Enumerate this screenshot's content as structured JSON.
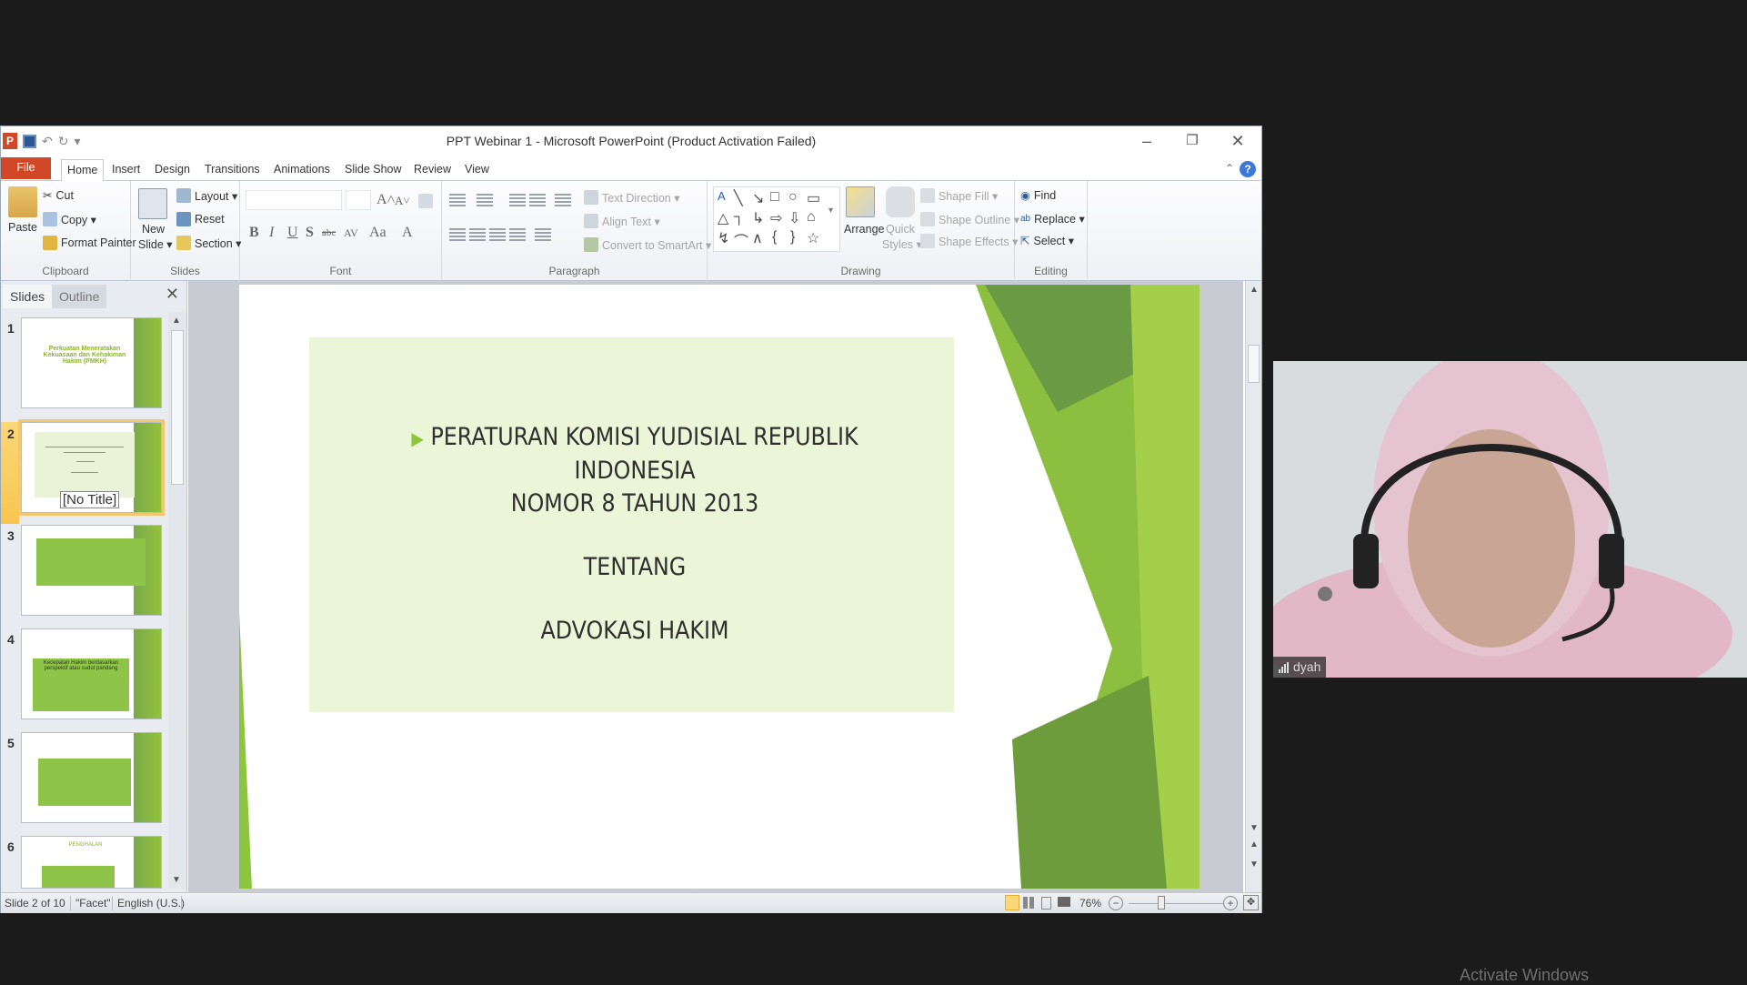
{
  "window": {
    "title": "PPT Webinar 1 - Microsoft PowerPoint (Product Activation Failed)",
    "app_icon_letter": "P",
    "controls": {
      "minimize": "–",
      "restore": "❐",
      "close": "✕"
    }
  },
  "quick_access": {
    "undo": "↶",
    "redo": "↻",
    "customize": "▾"
  },
  "tabs": [
    {
      "label": "File"
    },
    {
      "label": "Home",
      "active": true
    },
    {
      "label": "Insert"
    },
    {
      "label": "Design"
    },
    {
      "label": "Transitions"
    },
    {
      "label": "Animations"
    },
    {
      "label": "Slide Show"
    },
    {
      "label": "Review"
    },
    {
      "label": "View"
    }
  ],
  "help_label": "?",
  "ribbon": {
    "clipboard": {
      "label": "Clipboard",
      "paste": "Paste",
      "cut": "Cut",
      "copy": "Copy ▾",
      "format_painter": "Format Painter"
    },
    "slides": {
      "label": "Slides",
      "new_slide": "New",
      "new_slide2": "Slide ▾",
      "layout": "Layout ▾",
      "reset": "Reset",
      "section": "Section ▾"
    },
    "font": {
      "label": "Font",
      "font_name": "",
      "font_size": "",
      "bold": "B",
      "italic": "I",
      "underline": "U",
      "shadow": "S",
      "strike": "abc",
      "spacing": "AV",
      "case": "Aa",
      "color": "A",
      "grow": "A˄",
      "shrink": "A˅"
    },
    "paragraph": {
      "label": "Paragraph",
      "text_direction": "Text Direction ▾",
      "align_text": "Align Text ▾",
      "convert_smartart": "Convert to SmartArt ▾"
    },
    "drawing": {
      "label": "Drawing",
      "arrange": "Arrange",
      "quick_styles": "Quick",
      "quick_styles2": "Styles ▾",
      "shape_fill": "Shape Fill ▾",
      "shape_outline": "Shape Outline ▾",
      "shape_effects": "Shape Effects ▾",
      "shapes": [
        "╲",
        "↘",
        "□",
        "○",
        "▭",
        "△",
        "┐",
        "↳",
        "⇨",
        "⇩",
        "⌂",
        "↯",
        "⌒",
        "∧",
        "{",
        "}",
        "☆"
      ]
    },
    "editing": {
      "label": "Editing",
      "find": "Find",
      "replace": "Replace ▾",
      "select": "Select ▾"
    }
  },
  "slides_pane": {
    "tab_slides": "Slides",
    "tab_outline": "Outline",
    "close": "✕",
    "thumbnails": [
      {
        "number": "1",
        "title": "Perkuatan Meneratakan Kekuasaan dan Kehakiman Hakim (PMKH)"
      },
      {
        "number": "2",
        "selected": true,
        "tooltip": "[No Title]"
      },
      {
        "number": "3"
      },
      {
        "number": "4",
        "title": "Kecepatan Hakim berdasarkan perspektif atau sudut pandang"
      },
      {
        "number": "5"
      },
      {
        "number": "6",
        "title": "PENGHALAN"
      }
    ]
  },
  "slide": {
    "line1": "PERATURAN KOMISI YUDISIAL REPUBLIK INDONESIA",
    "line2": "NOMOR 8 TAHUN 2013",
    "line3": "TENTANG",
    "line4": "ADVOKASI HAKIM",
    "accent": "#8cc63f",
    "box_color": "#ebf5d7"
  },
  "status_bar": {
    "slide": "Slide 2 of 10",
    "theme": "\"Facet\"",
    "language": "English (U.S.)",
    "zoom": "76%"
  },
  "video": {
    "participant": "dyah"
  },
  "watermark": "Activate Windows"
}
